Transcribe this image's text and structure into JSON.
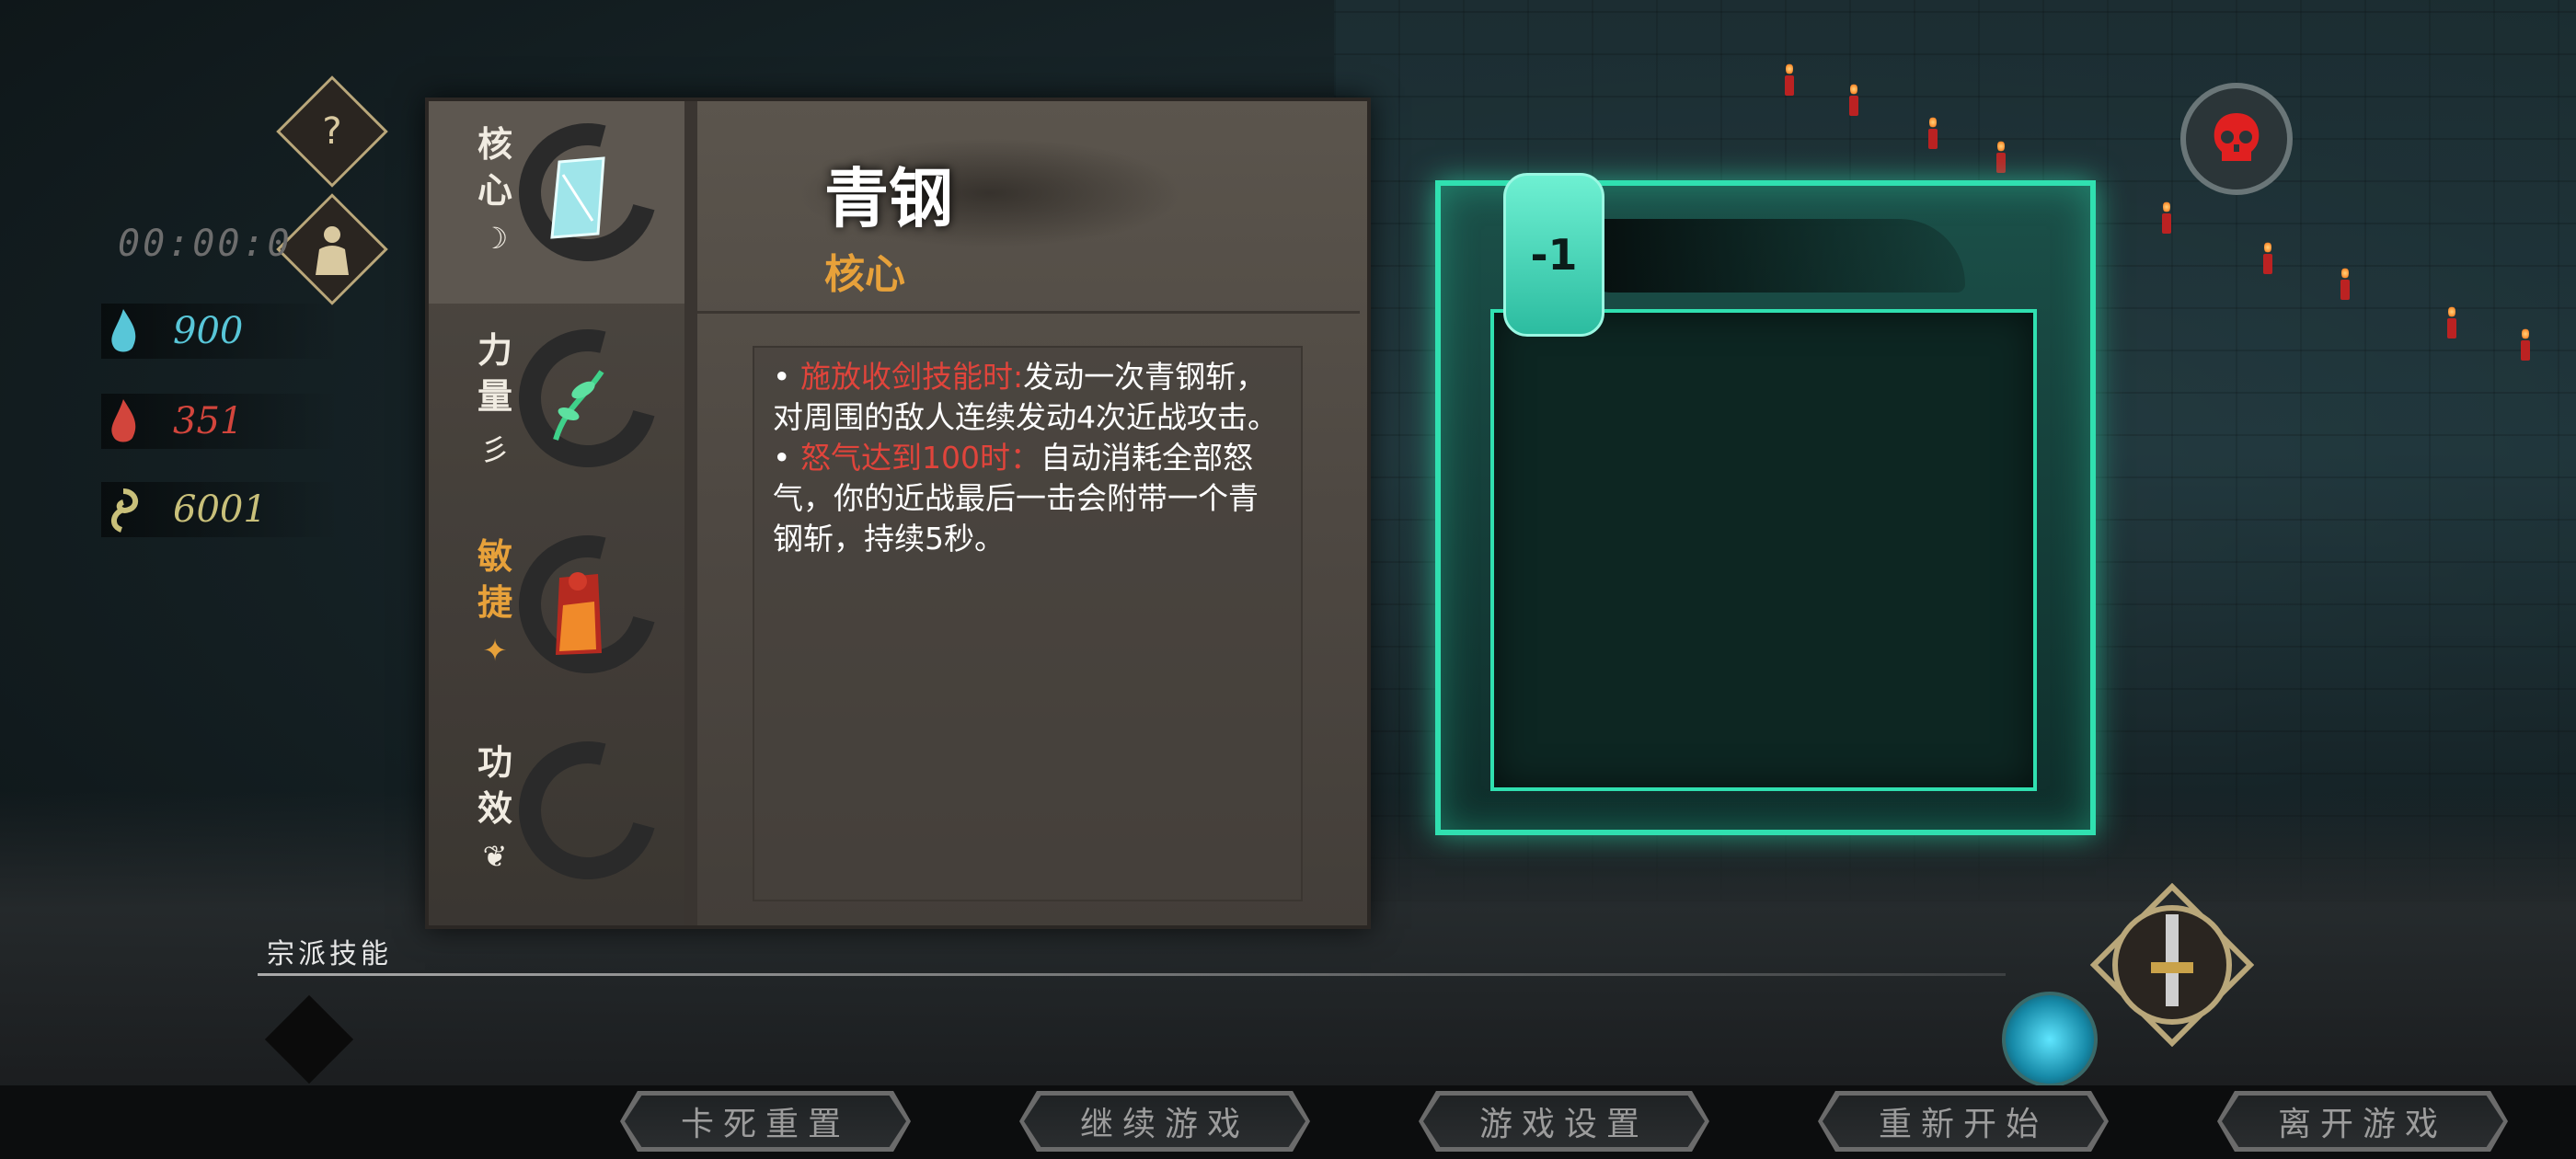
{
  "hud": {
    "help_icon": "question-icon",
    "character_icon": "character-icon",
    "timer": "00:00:0",
    "stats": [
      {
        "icon": "blue-flame-icon",
        "value": "900",
        "color": "#58c6d8"
      },
      {
        "icon": "red-flame-icon",
        "value": "351",
        "color": "#d2453c"
      },
      {
        "icon": "gold-swirl-icon",
        "value": "6001",
        "color": "#c9c07a"
      }
    ]
  },
  "panel": {
    "tabs": [
      {
        "label": "核心",
        "symbol": "☽",
        "icon": "ice-shard-icon"
      },
      {
        "label": "力量",
        "symbol": "彡",
        "icon": "green-vine-icon"
      },
      {
        "label": "敏捷",
        "symbol": "✦",
        "icon": "red-crystal-icon"
      },
      {
        "label": "功效",
        "symbol": "❦",
        "icon": "empty-slot"
      }
    ],
    "title": "青钢",
    "subtitle": "核心",
    "description": {
      "line1_red": "施放收剑技能时:",
      "line1_rest": "发动一次青钢斩，对周围的敌人连续发动4次近战攻击。",
      "line2_red": "怒气达到100时：",
      "line2_rest": "自动消耗全部怒气，你的近战最后一击会附带一个青钢斩，持续5秒。"
    }
  },
  "card": {
    "cost": "-1"
  },
  "skull_icon": "red-skull-icon",
  "bottom": {
    "section_label": "宗派技能",
    "menu": [
      "卡死重置",
      "继续游戏",
      "游戏设置",
      "重新开始",
      "离开游戏"
    ]
  },
  "colors": {
    "card_glow": "#30e0b0",
    "highlight_orange": "#e7a13a",
    "text_red": "#e0443b"
  }
}
